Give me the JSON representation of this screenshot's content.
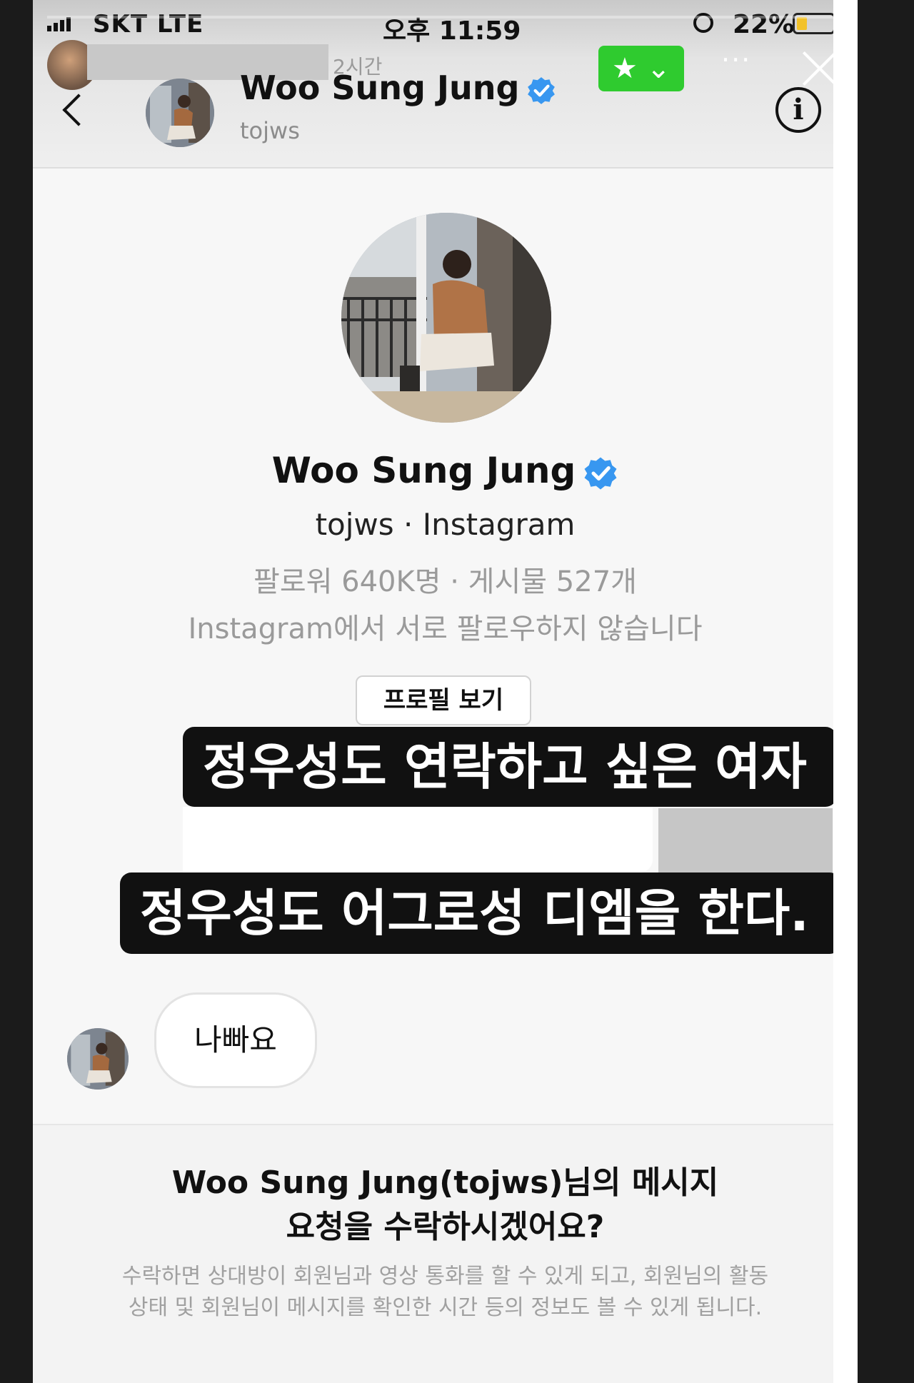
{
  "status_bar": {
    "carrier": "SKT  LTE",
    "time": "오후 11:59",
    "battery": "22%"
  },
  "story": {
    "timestamp": "2시간",
    "fav_label": "★ ⌄",
    "more_label": "···"
  },
  "header": {
    "name": "Woo Sung Jung",
    "username": "tojws"
  },
  "profile": {
    "name": "Woo Sung Jung",
    "meta": "tojws · Instagram",
    "stats": "팔로워 640K명 · 게시물 527개",
    "follow_note": "Instagram에서 서로 팔로우하지 않습니다",
    "view_profile_label": "프로필 보기"
  },
  "captions": {
    "line1": "정우성도 연락하고 싶은 여자",
    "line2": "정우성도 어그로성 디엠을 한다."
  },
  "message": {
    "text": "나빠요"
  },
  "request": {
    "title_line1": "Woo Sung Jung(tojws)님의 메시지",
    "title_line2": "요청을 수락하시겠어요?",
    "desc_line1": "수락하면 상대방이 회원님과 영상 통화를 할 수 있게 되고, 회원님의 활동",
    "desc_line2": "상태 및 회원님이 메시지를 확인한 시간 등의 정보도 볼 수 있게 됩니다."
  },
  "colors": {
    "verified": "#3897f0",
    "fav_green": "#2fcb2f",
    "caption_bg": "#111111"
  }
}
